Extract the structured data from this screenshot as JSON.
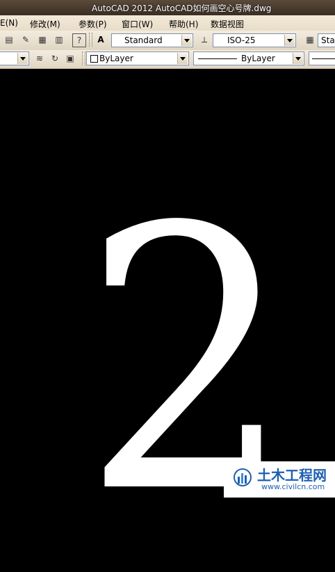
{
  "window": {
    "title": "AutoCAD 2012    AutoCAD如何画空心号牌.dwg"
  },
  "menu": [
    "E(N)",
    "修改(M)",
    "参数(P)",
    "窗口(W)",
    "帮助(H)",
    "数据视图"
  ],
  "styles": {
    "text_style": "Standard",
    "dim_style": "ISO-25",
    "table_style": "Star"
  },
  "properties": {
    "color": "ByLayer",
    "linetype": "ByLayer"
  },
  "drawing": {
    "numeral": "2"
  },
  "watermark": {
    "brand": "土木工程网",
    "url": "www.civilcn.com"
  },
  "colors": {
    "canvas": "#000000",
    "drawing": "#ffffff",
    "brand": "#1f5fb0"
  }
}
